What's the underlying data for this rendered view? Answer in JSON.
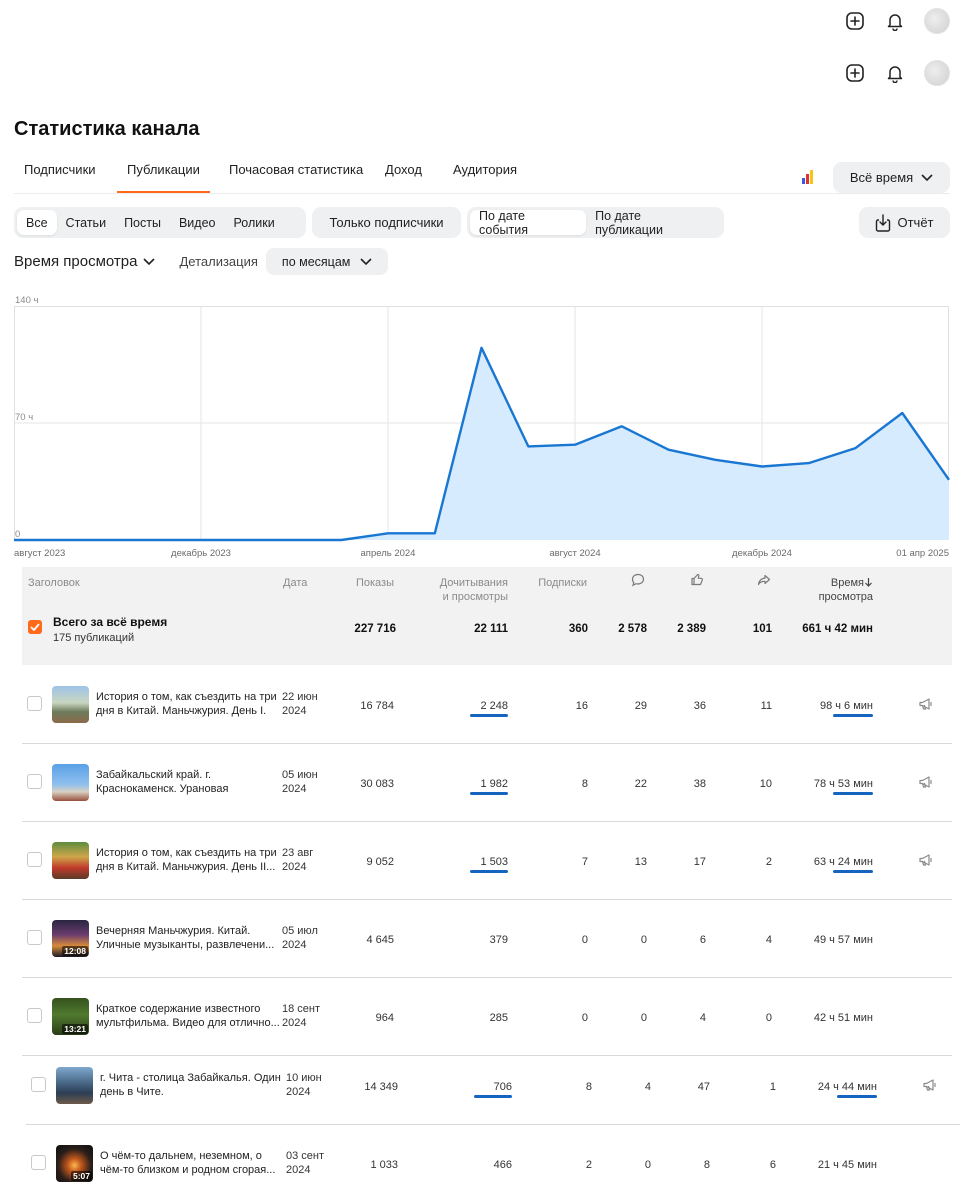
{
  "page": {
    "title": "Статистика канала"
  },
  "tabs": [
    {
      "label": "Подписчики",
      "active": false
    },
    {
      "label": "Публикации",
      "active": true
    },
    {
      "label": "Почасовая статистика",
      "active": false
    },
    {
      "label": "Доход",
      "active": false
    },
    {
      "label": "Аудитория",
      "active": false
    }
  ],
  "period": {
    "label": "Всё время"
  },
  "filters": {
    "types": [
      "Все",
      "Статьи",
      "Посты",
      "Видео",
      "Ролики"
    ],
    "subscribers_only": "Только подписчики",
    "date_modes": [
      "По дате события",
      "По дате публикации"
    ],
    "report": "Отчёт"
  },
  "metric": {
    "label": "Время просмотра",
    "detail_label": "Детализация",
    "detail_value": "по месяцам"
  },
  "chart_data": {
    "type": "area",
    "y_ticks": [
      "140 ч",
      "70 ч",
      "0"
    ],
    "ylim": [
      0,
      140
    ],
    "x_labels": [
      "август 2023",
      "декабрь 2024",
      "апрель 2024",
      "август 2024",
      "декабрь 2024",
      "01 апр 2025"
    ],
    "x_label_texts": [
      "август 2023",
      "декабрь 2023",
      "апрель 2024",
      "август 2024",
      "декабрь 2024",
      "01 апр 2025"
    ],
    "x": [
      "2023-08",
      "2023-09",
      "2023-10",
      "2023-11",
      "2023-12",
      "2024-01",
      "2024-02",
      "2024-03",
      "2024-04",
      "2024-05",
      "2024-06",
      "2024-07",
      "2024-08",
      "2024-09",
      "2024-10",
      "2024-11",
      "2024-12",
      "2025-01",
      "2025-02",
      "2025-03",
      "2025-04"
    ],
    "values": [
      0,
      0,
      0,
      0,
      0,
      0,
      0,
      0,
      4,
      4,
      115,
      56,
      57,
      68,
      54,
      48,
      44,
      46,
      55,
      76,
      36
    ],
    "grid": true,
    "color": "#1976d2",
    "fill": "#d6ebfd"
  },
  "table": {
    "headers": {
      "title": "Заголовок",
      "date": "Дата",
      "impressions": "Показы",
      "reads_l1": "Дочитывания",
      "reads_l2": "и просмотры",
      "subs": "Подписки",
      "comments_icon": "comment-icon",
      "likes_icon": "like-icon",
      "shares_icon": "share-icon",
      "time_l1": "Время",
      "time_l2": "просмотра"
    },
    "total": {
      "title": "Всего за всё время",
      "subtitle": "175 публикаций",
      "impressions": "227 716",
      "reads": "22 111",
      "subs": "360",
      "comments": "2 578",
      "likes": "2 389",
      "shares": "101",
      "time": "661 ч 42 мин"
    },
    "rows": [
      {
        "title": "История о том, как съездить на три дня в Китай. Маньчжурия. День I.",
        "date_l1": "22 июн",
        "date_l2": "2024",
        "impressions": "16 784",
        "reads": "2 248",
        "subs": "16",
        "comments": "29",
        "likes": "36",
        "shares": "11",
        "time": "98 ч 6 мин",
        "duration": "",
        "read_bar": 0.9,
        "time_bar": 0.95,
        "promo": true
      },
      {
        "title": "Забайкальский край. г. Краснокаменск. Урановая столица...",
        "date_l1": "05 июн",
        "date_l2": "2024",
        "impressions": "30 083",
        "reads": "1 982",
        "subs": "8",
        "comments": "22",
        "likes": "38",
        "shares": "10",
        "time": "78 ч 53 мин",
        "duration": "",
        "read_bar": 0.9,
        "time_bar": 0.95,
        "promo": true
      },
      {
        "title": "История о том, как съездить на три дня в Китай. Маньчжурия. День II...",
        "date_l1": "23 авг",
        "date_l2": "2024",
        "impressions": "9 052",
        "reads": "1 503",
        "subs": "7",
        "comments": "13",
        "likes": "17",
        "shares": "2",
        "time": "63 ч 24 мин",
        "duration": "",
        "read_bar": 0.9,
        "time_bar": 0.95,
        "promo": true
      },
      {
        "title": "Вечерняя Маньчжурия. Китай. Уличные музыканты, развлечени...",
        "date_l1": "05 июл",
        "date_l2": "2024",
        "impressions": "4 645",
        "reads": "379",
        "subs": "0",
        "comments": "0",
        "likes": "6",
        "shares": "4",
        "time": "49 ч 57 мин",
        "duration": "12:08",
        "read_bar": 0,
        "time_bar": 0,
        "promo": false
      },
      {
        "title": "Краткое содержание известного мультфильма. Видео для отлично...",
        "date_l1": "18 сент",
        "date_l2": "2024",
        "impressions": "964",
        "reads": "285",
        "subs": "0",
        "comments": "0",
        "likes": "4",
        "shares": "0",
        "time": "42 ч 51 мин",
        "duration": "13:21",
        "read_bar": 0,
        "time_bar": 0,
        "promo": false
      },
      {
        "title": "г. Чита - столица Забайкалья. Один день в Чите.",
        "date_l1": "10 июн",
        "date_l2": "2024",
        "impressions": "14 349",
        "reads": "706",
        "subs": "8",
        "comments": "4",
        "likes": "47",
        "shares": "1",
        "time": "24 ч 44 мин",
        "duration": "",
        "read_bar": 0.9,
        "time_bar": 0.95,
        "promo": true
      },
      {
        "title": "О чём-то дальнем, неземном, о чём-то близком и родном сгорая...",
        "date_l1": "03 сент",
        "date_l2": "2024",
        "impressions": "1 033",
        "reads": "466",
        "subs": "2",
        "comments": "0",
        "likes": "8",
        "shares": "6",
        "time": "21 ч 45 мин",
        "duration": "5:07",
        "read_bar": 0,
        "time_bar": 0,
        "promo": false
      }
    ]
  }
}
